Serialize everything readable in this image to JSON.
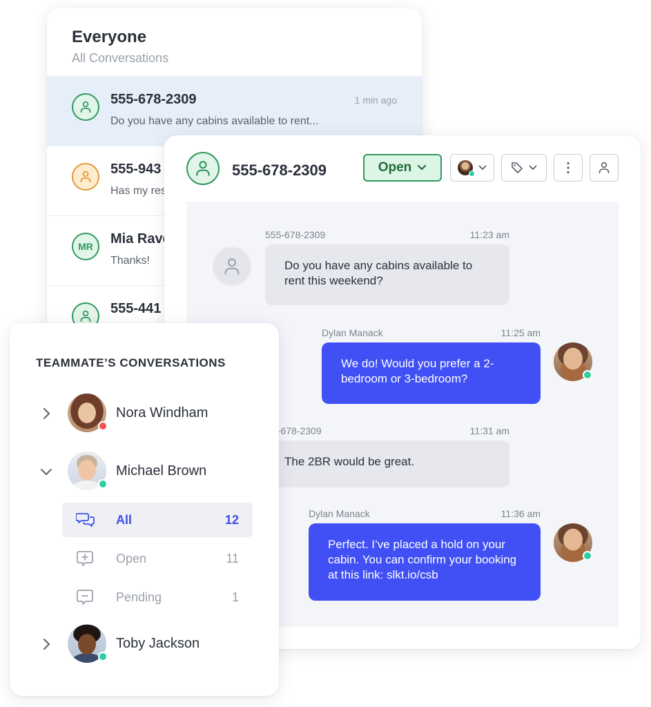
{
  "conversation_list": {
    "title": "Everyone",
    "subtitle": "All Conversations",
    "rows": [
      {
        "name": "555-678-2309",
        "time": "1 min ago",
        "preview": "Do you have any cabins available to rent...",
        "avatar_initials": ""
      },
      {
        "name": "555-943",
        "time": "",
        "preview": "Has my res",
        "avatar_initials": ""
      },
      {
        "name": "Mia Rave",
        "time": "",
        "preview": "Thanks!",
        "avatar_initials": "MR"
      },
      {
        "name": "555-441",
        "time": "",
        "preview": "",
        "avatar_initials": ""
      }
    ]
  },
  "chat": {
    "contact": "555-678-2309",
    "status_button": "Open",
    "messages": [
      {
        "sender": "555-678-2309",
        "time": "11:23 am",
        "text": "Do you have any cabins available to rent this weekend?"
      },
      {
        "sender": "Dylan Manack",
        "time": "11:25 am",
        "text": "We do! Would you prefer a 2-bedroom or 3-bedroom?"
      },
      {
        "sender": "5-678-2309",
        "time": "11:31 am",
        "text": "The 2BR would be great."
      },
      {
        "sender": "Dylan Manack",
        "time": "11:36 am",
        "text": "Perfect. I’ve placed a hold on your cabin. You can confirm your booking at this link: slkt.io/csb"
      }
    ]
  },
  "teammates": {
    "title": "TEAMMATE’S CONVERSATIONS",
    "people": [
      {
        "name": "Nora Windham",
        "presence_color": "#ef5350"
      },
      {
        "name": "Michael Brown",
        "presence_color": "#2ecfa2"
      },
      {
        "name": "Toby Jackson",
        "presence_color": "#2ecfa2"
      }
    ],
    "filters": [
      {
        "label": "All",
        "count": "12"
      },
      {
        "label": "Open",
        "count": "11"
      },
      {
        "label": "Pending",
        "count": "1"
      }
    ]
  },
  "colors": {
    "accent": "#4050f5",
    "open_green": "#2f9a5c",
    "selected_row": "#e6eef9"
  }
}
